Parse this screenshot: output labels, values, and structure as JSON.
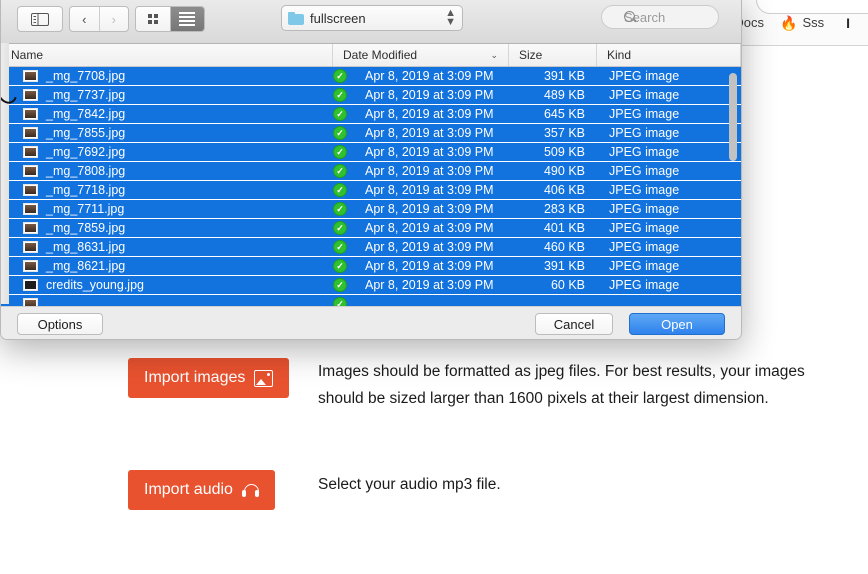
{
  "browser": {
    "bookmarks": [
      {
        "label": "Docs",
        "icon": ""
      },
      {
        "label": "Sss",
        "icon": "flame-icon"
      },
      {
        "label": "I",
        "icon": ""
      }
    ],
    "flame_glyph": "🔥"
  },
  "dialog": {
    "toolbar": {
      "sidebar_toggle": "sidebar-toggle-icon",
      "back": "‹",
      "forward": "›",
      "icon_view": "grid-view-icon",
      "list_view": "list-view-icon",
      "path_label": "fullscreen",
      "path_stepper": "⌃⌄",
      "search_placeholder": "Search"
    },
    "columns": {
      "name": "Name",
      "date_modified": "Date Modified",
      "sort_arrow": "⌄",
      "size": "Size",
      "kind": "Kind"
    },
    "files": [
      {
        "name": "_mg_7708.jpg",
        "badge": "✓",
        "date": "Apr 8, 2019 at 3:09 PM",
        "size": "391 KB",
        "kind": "JPEG image",
        "thumb": "photo"
      },
      {
        "name": "_mg_7737.jpg",
        "badge": "✓",
        "date": "Apr 8, 2019 at 3:09 PM",
        "size": "489 KB",
        "kind": "JPEG image",
        "thumb": "photo"
      },
      {
        "name": "_mg_7842.jpg",
        "badge": "✓",
        "date": "Apr 8, 2019 at 3:09 PM",
        "size": "645 KB",
        "kind": "JPEG image",
        "thumb": "photo"
      },
      {
        "name": "_mg_7855.jpg",
        "badge": "✓",
        "date": "Apr 8, 2019 at 3:09 PM",
        "size": "357 KB",
        "kind": "JPEG image",
        "thumb": "photo"
      },
      {
        "name": "_mg_7692.jpg",
        "badge": "✓",
        "date": "Apr 8, 2019 at 3:09 PM",
        "size": "509 KB",
        "kind": "JPEG image",
        "thumb": "photo"
      },
      {
        "name": "_mg_7808.jpg",
        "badge": "✓",
        "date": "Apr 8, 2019 at 3:09 PM",
        "size": "490 KB",
        "kind": "JPEG image",
        "thumb": "photo"
      },
      {
        "name": "_mg_7718.jpg",
        "badge": "✓",
        "date": "Apr 8, 2019 at 3:09 PM",
        "size": "406 KB",
        "kind": "JPEG image",
        "thumb": "photo"
      },
      {
        "name": "_mg_7711.jpg",
        "badge": "✓",
        "date": "Apr 8, 2019 at 3:09 PM",
        "size": "283 KB",
        "kind": "JPEG image",
        "thumb": "photo"
      },
      {
        "name": "_mg_7859.jpg",
        "badge": "✓",
        "date": "Apr 8, 2019 at 3:09 PM",
        "size": "401 KB",
        "kind": "JPEG image",
        "thumb": "photo"
      },
      {
        "name": "_mg_8631.jpg",
        "badge": "✓",
        "date": "Apr 8, 2019 at 3:09 PM",
        "size": "460 KB",
        "kind": "JPEG image",
        "thumb": "photo"
      },
      {
        "name": "_mg_8621.jpg",
        "badge": "✓",
        "date": "Apr 8, 2019 at 3:09 PM",
        "size": "391 KB",
        "kind": "JPEG image",
        "thumb": "photo"
      },
      {
        "name": "credits_young.jpg",
        "badge": "✓",
        "date": "Apr 8, 2019 at 3:09 PM",
        "size": "60 KB",
        "kind": "JPEG image",
        "thumb": "dark"
      },
      {
        "name": "",
        "badge": "✓",
        "date": "",
        "size": "",
        "kind": "",
        "thumb": "photo"
      }
    ],
    "footer": {
      "options_label": "Options",
      "cancel_label": "Cancel",
      "open_label": "Open"
    }
  },
  "page": {
    "import_images": {
      "button_label": "Import images",
      "button_icon": "picture-icon",
      "description": "Images should be formatted as jpeg files. For best results, your images should be sized larger than 1600 pixels at their largest dimension."
    },
    "import_audio": {
      "button_label": "Import audio",
      "button_icon": "headphones-icon",
      "description": "Select your audio mp3 file."
    }
  },
  "colors": {
    "selection_blue": "#1272de",
    "open_button_blue": "#2d82ec",
    "import_orange": "#e8522f",
    "badge_green": "#30c030"
  }
}
